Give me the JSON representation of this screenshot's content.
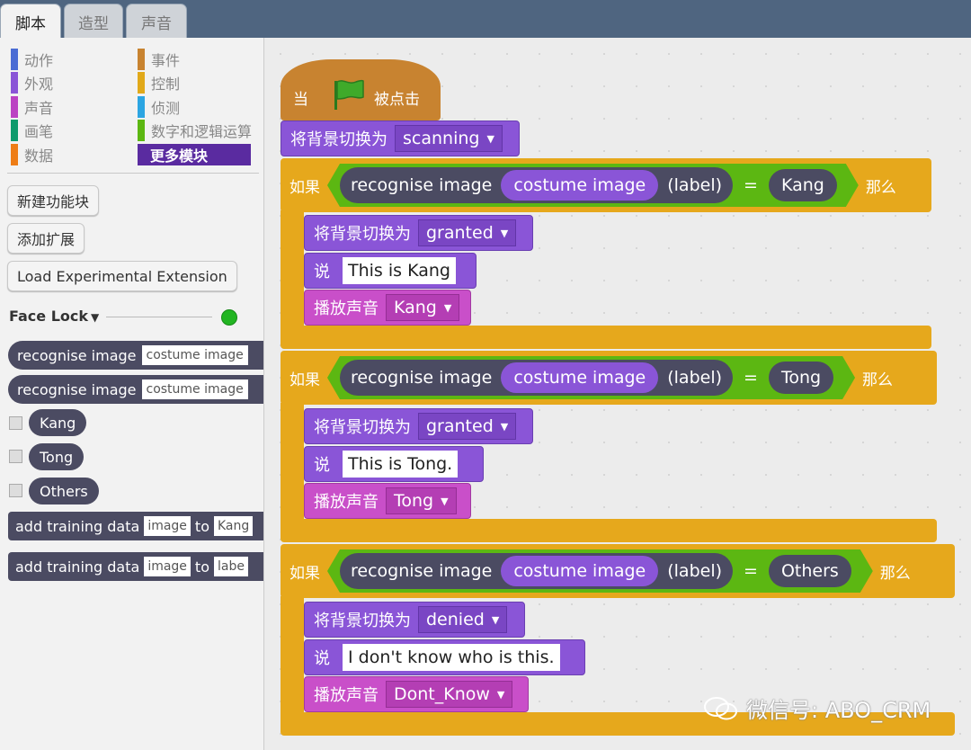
{
  "tabs": [
    {
      "label": "脚本"
    },
    {
      "label": "造型"
    },
    {
      "label": "声音"
    }
  ],
  "categories": {
    "left": [
      {
        "label": "动作",
        "color": "#4a6cd4"
      },
      {
        "label": "外观",
        "color": "#8a55d7"
      },
      {
        "label": "声音",
        "color": "#bb42c3"
      },
      {
        "label": "画笔",
        "color": "#0e9a6c"
      },
      {
        "label": "数据",
        "color": "#ee7d16"
      }
    ],
    "right": [
      {
        "label": "事件",
        "color": "#c88330"
      },
      {
        "label": "控制",
        "color": "#e1a91a"
      },
      {
        "label": "侦测",
        "color": "#2ca5e2"
      },
      {
        "label": "数字和逻辑运算",
        "color": "#5cb712"
      },
      {
        "label": "更多模块",
        "color": "#632d99"
      }
    ]
  },
  "palette": {
    "new_block_btn": "新建功能块",
    "add_ext_btn": "添加扩展",
    "load_exp_btn": "Load Experimental Extension",
    "extension_name": "Face Lock",
    "blocks": {
      "recognise1": {
        "label": "recognise image",
        "slot": "costume image"
      },
      "recognise2": {
        "label": "recognise image",
        "slot": "costume image"
      },
      "labels": [
        "Kang",
        "Tong",
        "Others"
      ],
      "train1": {
        "label": "add training data",
        "slot": "image",
        "to": "to",
        "target": "Kang"
      },
      "train2": {
        "label": "add training data",
        "slot": "image",
        "to": "to",
        "target": "labe"
      }
    }
  },
  "script": {
    "hat": {
      "when": "当",
      "clicked": "被点击",
      "flag_color": "#3faa2a"
    },
    "switch_backdrop": {
      "label": "将背景切换为",
      "value": "scanning"
    },
    "if_label": "如果",
    "then_label": "那么",
    "ifs": [
      {
        "reporter": "recognise image",
        "input": "costume image",
        "suffix": "(label)",
        "eq": "=",
        "value": "Kang",
        "backdrop_label": "将背景切换为",
        "backdrop": "granted",
        "say_label": "说",
        "say": "This is Kang",
        "sound_label": "播放声音",
        "sound": "Kang"
      },
      {
        "reporter": "recognise image",
        "input": "costume image",
        "suffix": "(label)",
        "eq": "=",
        "value": "Tong",
        "backdrop_label": "将背景切换为",
        "backdrop": "granted",
        "say_label": "说",
        "say": "This is Tong.",
        "sound_label": "播放声音",
        "sound": "Tong"
      },
      {
        "reporter": "recognise image",
        "input": "costume image",
        "suffix": "(label)",
        "eq": "=",
        "value": "Others",
        "backdrop_label": "将背景切换为",
        "backdrop": "denied",
        "say_label": "说",
        "say": "I don't know who is this.",
        "sound_label": "播放声音",
        "sound": "Dont_Know"
      }
    ]
  },
  "watermark": "微信号: ABO_CRM"
}
